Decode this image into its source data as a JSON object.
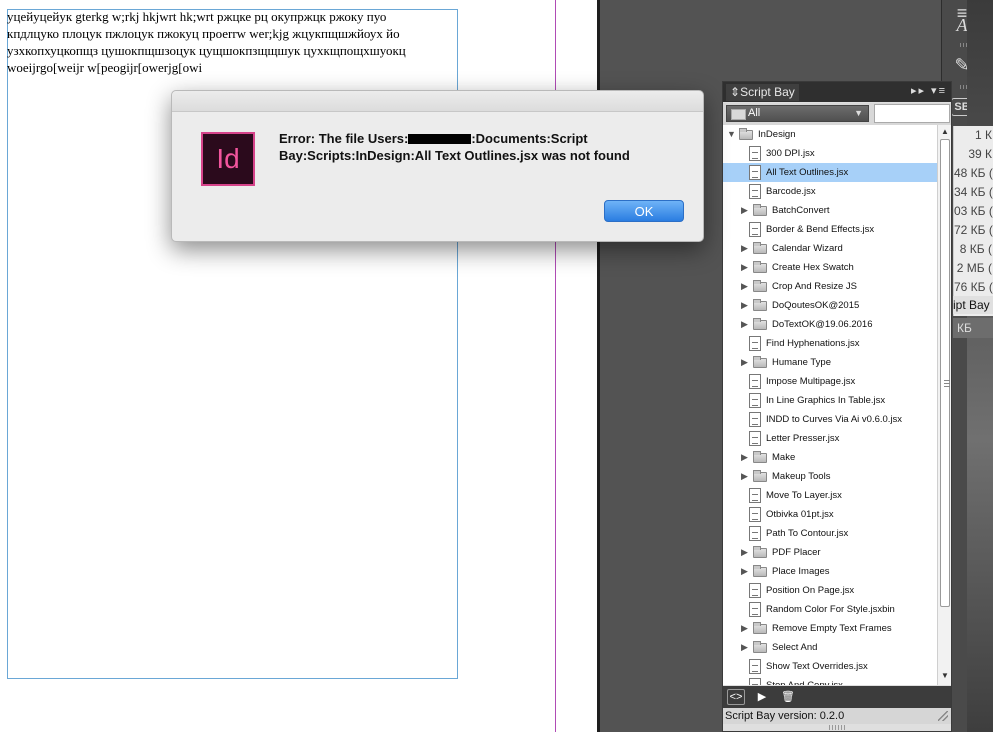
{
  "document": {
    "text_lines": [
      "уцейуцейук gterkg w;rkj hkjwrt hk;wrt ржцке рц окупржцк ржоку пуо",
      "кпдлцуко плоцук пжлоцук пжокуц проеrrw wer;kjg жцукпщшжйоух йо",
      "узхкопхуцкопщз цушокпщшзоцук  цущшокпзщщшук цухкщпощхшуокц",
      "woeijrgo[weijr w[peogijr[owerjg[owi"
    ]
  },
  "dialog": {
    "app_icon_text": "Id",
    "message_part1": "Error: The file Users:",
    "message_part2": ":Documents:Script Bay:Scripts:InDesign:All Text Outlines.jsx was not found",
    "ok_label": "OK"
  },
  "tools": {
    "type_tool": "A",
    "script_bay_icon": "SB"
  },
  "background_list": {
    "sizes": [
      "1 К",
      "39 К",
      "48 КБ (",
      "34 КБ (",
      "03 КБ (",
      "72 КБ (",
      "8 КБ (",
      "2 МБ (",
      "76 КБ ("
    ],
    "title_fragment": "ipt Bay",
    "unit_fragment": "КБ"
  },
  "panel": {
    "title": "Script Bay",
    "header_controls": "▸▸ ▾≡",
    "filter_value": "All",
    "search_value": "",
    "version_text": "Script Bay version: 0.2.0",
    "tree": [
      {
        "label": "InDesign",
        "type": "folder",
        "level": 0,
        "expanded": true
      },
      {
        "label": "300 DPI.jsx",
        "type": "file",
        "level": 1
      },
      {
        "label": "All Text Outlines.jsx",
        "type": "file",
        "level": 1,
        "selected": true
      },
      {
        "label": "Barcode.jsx",
        "type": "file",
        "level": 1
      },
      {
        "label": "BatchConvert",
        "type": "folder",
        "level": 1
      },
      {
        "label": "Border & Bend Effects.jsx",
        "type": "file",
        "level": 1
      },
      {
        "label": "Calendar Wizard",
        "type": "folder",
        "level": 1
      },
      {
        "label": "Create Hex Swatch",
        "type": "folder",
        "level": 1
      },
      {
        "label": "Crop And Resize JS",
        "type": "folder",
        "level": 1
      },
      {
        "label": "DoQoutesOK@2015",
        "type": "folder",
        "level": 1
      },
      {
        "label": "DoTextOK@19.06.2016",
        "type": "folder",
        "level": 1
      },
      {
        "label": "Find Hyphenations.jsx",
        "type": "file",
        "level": 1
      },
      {
        "label": "Humane Type",
        "type": "folder",
        "level": 1
      },
      {
        "label": "Impose Multipage.jsx",
        "type": "file",
        "level": 1
      },
      {
        "label": "In Line Graphics In Table.jsx",
        "type": "file",
        "level": 1
      },
      {
        "label": "INDD to Curves Via Ai v0.6.0.jsx",
        "type": "file",
        "level": 1
      },
      {
        "label": "Letter Presser.jsx",
        "type": "file",
        "level": 1
      },
      {
        "label": "Make",
        "type": "folder",
        "level": 1
      },
      {
        "label": "Makeup Tools",
        "type": "folder",
        "level": 1
      },
      {
        "label": "Move To Layer.jsx",
        "type": "file",
        "level": 1
      },
      {
        "label": "Otbivka 01pt.jsx",
        "type": "file",
        "level": 1
      },
      {
        "label": "Path To Contour.jsx",
        "type": "file",
        "level": 1
      },
      {
        "label": "PDF Placer",
        "type": "folder",
        "level": 1
      },
      {
        "label": "Place Images",
        "type": "folder",
        "level": 1
      },
      {
        "label": "Position On Page.jsx",
        "type": "file",
        "level": 1
      },
      {
        "label": "Random Color For Style.jsxbin",
        "type": "file",
        "level": 1
      },
      {
        "label": "Remove Empty Text Frames",
        "type": "folder",
        "level": 1
      },
      {
        "label": "Select And",
        "type": "folder",
        "level": 1
      },
      {
        "label": "Show Text Overrides.jsx",
        "type": "file",
        "level": 1
      },
      {
        "label": "Stop And Copy.jsx",
        "type": "file",
        "level": 1
      }
    ]
  },
  "colors": {
    "accent_blue": "#2a7de1",
    "selection": "#a7d0f8",
    "indesign_pink": "#f2559d",
    "column_guide": "#b04bb5"
  }
}
